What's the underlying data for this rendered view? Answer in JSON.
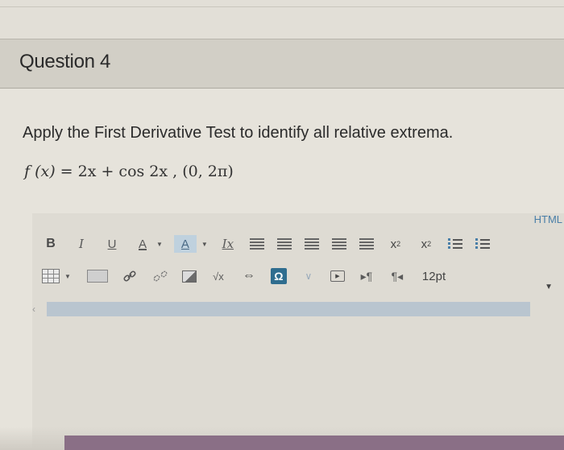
{
  "question": {
    "title": "Question 4",
    "prompt": "Apply the First Derivative Test to identify all relative extrema.",
    "formula_lhs": "f (x)",
    "formula_rhs": " = 2x + cos 2x ,   (0, 2π)"
  },
  "editor": {
    "html_tab": "HTML",
    "toolbar1": {
      "bold": "B",
      "italic": "I",
      "underline": "U",
      "font_color": "A",
      "bg_color": "A",
      "clear_format": "Ix",
      "superscript": "x",
      "subscript": "x"
    },
    "toolbar2": {
      "omega": "Ω",
      "sqrt": "√x",
      "font_size": "12pt"
    },
    "icons": {
      "bold": "bold-icon",
      "italic": "italic-icon",
      "underline": "underline-icon",
      "font_color": "font-color-icon",
      "bg_color": "background-color-icon",
      "clear_format": "clear-formatting-icon",
      "align_left": "align-left-icon",
      "align_center": "align-center-icon",
      "align_right": "align-right-icon",
      "align_justify": "align-justify-icon",
      "indent": "indent-icon",
      "superscript": "superscript-icon",
      "subscript": "subscript-icon",
      "bullet_list": "bullet-list-icon",
      "numbered_list": "numbered-list-icon",
      "table": "table-icon",
      "media": "media-icon",
      "link": "link-icon",
      "unlink": "unlink-icon",
      "image": "image-icon",
      "equation": "equation-icon",
      "embed": "embed-icon",
      "special_char": "omega-icon",
      "chevron": "chevron-down-icon",
      "video": "video-icon",
      "ltr": "ltr-icon",
      "rtl": "rtl-icon"
    },
    "colors": {
      "accent": "#2f6d8f",
      "link_blue": "#4a7fa8",
      "scrollbar": "#b9c5cf"
    }
  }
}
